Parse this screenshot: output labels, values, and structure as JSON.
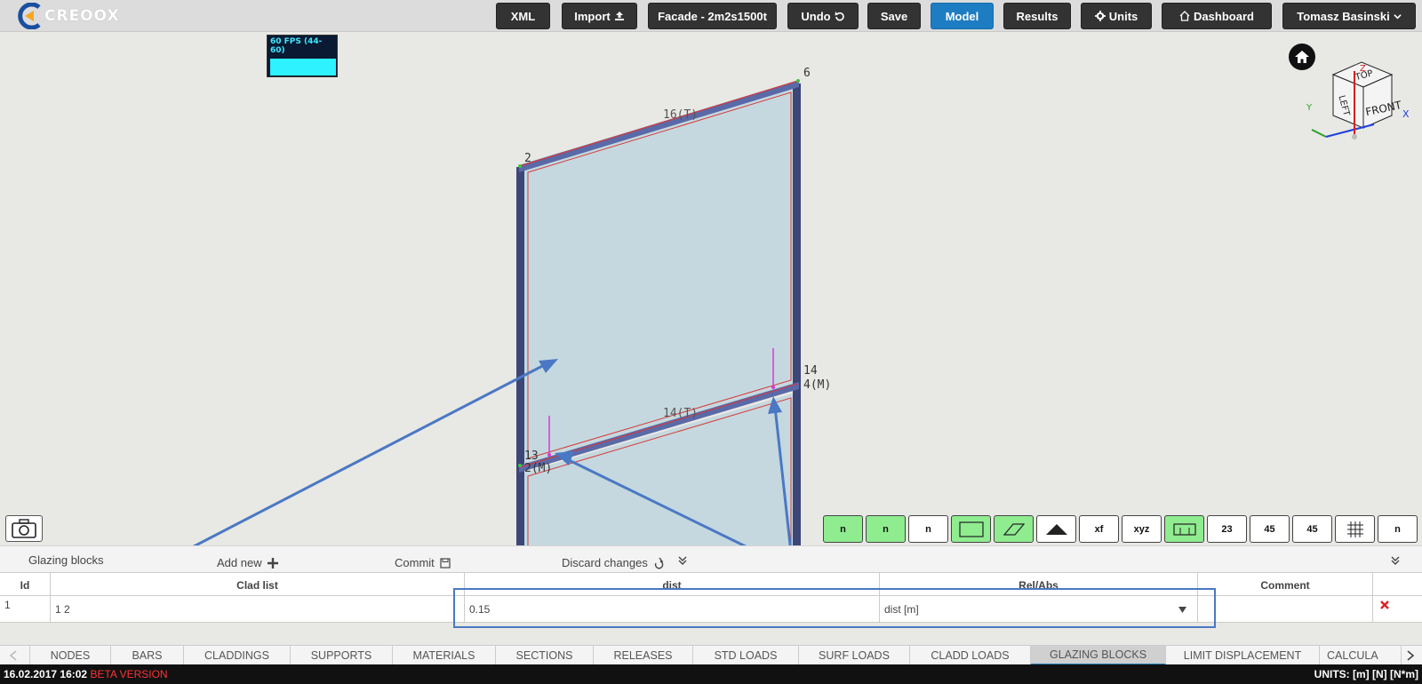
{
  "app": {
    "logo_text": "CREOOX"
  },
  "nav": {
    "xml": "XML",
    "import": "Import",
    "facade": "Facade - 2m2s1500t",
    "undo": "Undo",
    "save": "Save",
    "model": "Model",
    "results": "Results",
    "units": "Units",
    "dashboard": "Dashboard",
    "user": "Tomasz Basinski"
  },
  "fps": {
    "label": "60 FPS (44-60)"
  },
  "scene": {
    "node_labels": [
      "6",
      "2",
      "14",
      "4(M)",
      "13",
      "2(M)"
    ],
    "bar_labels": [
      "16(T)",
      "14(T)"
    ]
  },
  "navcube": {
    "top": "TOP",
    "left": "LEFT",
    "front": "FRONT",
    "axis_x": "X",
    "axis_y": "Y",
    "axis_z": "Z"
  },
  "toolbar": [
    "n",
    "n",
    "n",
    "",
    "",
    "",
    "xf",
    "xyz",
    "",
    "23",
    "45",
    "45",
    "",
    "n"
  ],
  "panel": {
    "title": "Glazing blocks",
    "add_new": "Add new",
    "commit": "Commit",
    "discard": "Discard changes"
  },
  "table": {
    "columns": [
      "Id",
      "Clad list",
      "dist",
      "Rel/Abs",
      "Comment"
    ],
    "rows": [
      {
        "id": "1",
        "clad_list": "1 2",
        "dist": "0.15",
        "rel_abs": "dist [m]",
        "comment": ""
      }
    ]
  },
  "tabs": [
    "NODES",
    "BARS",
    "CLADDINGS",
    "SUPPORTS",
    "MATERIALS",
    "SECTIONS",
    "RELEASES",
    "STD LOADS",
    "SURF LOADS",
    "CLADD LOADS",
    "GLAZING BLOCKS",
    "LIMIT DISPLACEMENT",
    "CALCULA"
  ],
  "active_tab": "GLAZING BLOCKS",
  "status": {
    "date": "16.02.2017 16:02",
    "beta": "BETA VERSION",
    "units": "UNITS: [m] [N] [N*m]"
  },
  "colors": {
    "accent": "#1e7dc2",
    "tool_active": "#8fec8f",
    "annotation": "#4a78c4",
    "glass": "#c5d8df"
  }
}
